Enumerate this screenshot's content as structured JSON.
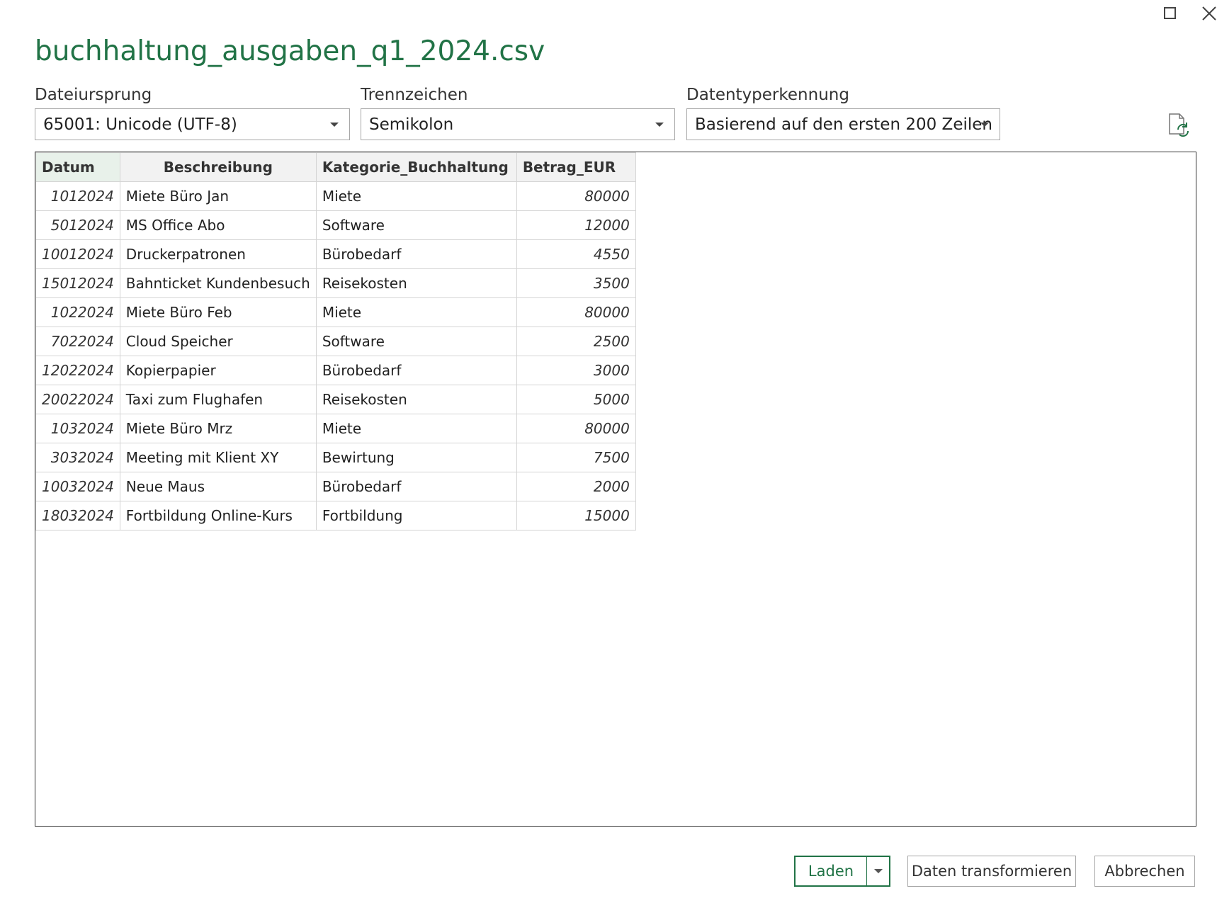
{
  "window": {
    "title": "buchhaltung_ausgaben_q1_2024.csv"
  },
  "options": {
    "file_origin": {
      "label": "Dateiursprung",
      "value": "65001: Unicode (UTF-8)"
    },
    "delimiter": {
      "label": "Trennzeichen",
      "value": "Semikolon"
    },
    "type_detection": {
      "label": "Datentyperkennung",
      "value": "Basierend auf den ersten 200 Zeilen"
    }
  },
  "table": {
    "columns": [
      "Datum",
      "Beschreibung",
      "Kategorie_Buchhaltung",
      "Betrag_EUR"
    ],
    "rows": [
      [
        "1012024",
        "Miete Büro Jan",
        "Miete",
        "80000"
      ],
      [
        "5012024",
        "MS Office Abo",
        "Software",
        "12000"
      ],
      [
        "10012024",
        "Druckerpatronen",
        "Bürobedarf",
        "4550"
      ],
      [
        "15012024",
        "Bahnticket Kundenbesuch",
        "Reisekosten",
        "3500"
      ],
      [
        "1022024",
        "Miete Büro Feb",
        "Miete",
        "80000"
      ],
      [
        "7022024",
        "Cloud Speicher",
        "Software",
        "2500"
      ],
      [
        "12022024",
        "Kopierpapier",
        "Bürobedarf",
        "3000"
      ],
      [
        "20022024",
        "Taxi zum Flughafen",
        "Reisekosten",
        "5000"
      ],
      [
        "1032024",
        "Miete Büro Mrz",
        "Miete",
        "80000"
      ],
      [
        "3032024",
        "Meeting mit Klient XY",
        "Bewirtung",
        "7500"
      ],
      [
        "10032024",
        "Neue Maus",
        "Bürobedarf",
        "2000"
      ],
      [
        "18032024",
        "Fortbildung Online-Kurs",
        "Fortbildung",
        "15000"
      ]
    ]
  },
  "buttons": {
    "load": "Laden",
    "transform": "Daten transformieren",
    "cancel": "Abbrechen"
  },
  "colors": {
    "accent": "#217346"
  },
  "icons": [
    "maximize-icon",
    "close-icon",
    "chevron-down-icon",
    "refresh-file-icon"
  ]
}
